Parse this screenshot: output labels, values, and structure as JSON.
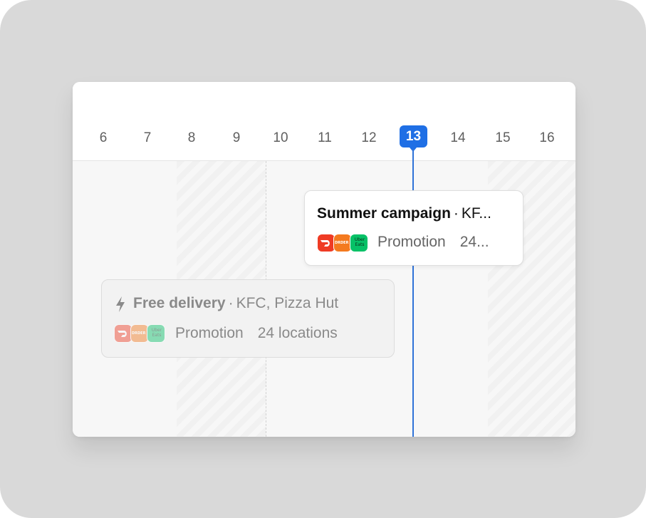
{
  "timeline": {
    "days": [
      "6",
      "7",
      "8",
      "9",
      "10",
      "11",
      "12",
      "13",
      "14",
      "15",
      "16"
    ],
    "today": "13"
  },
  "events": {
    "active": {
      "title": "Summer campaign",
      "brands": "KF...",
      "type": "Promotion",
      "locations": "24..."
    },
    "faded": {
      "title": "Free delivery",
      "brands": "KFC, Pizza Hut",
      "type": "Promotion",
      "locations": "24 locations"
    }
  },
  "logos": {
    "delivery_one": "doordash-icon",
    "delivery_two": "orange-delivery-icon",
    "delivery_three_text": "Uber Eats"
  },
  "colors": {
    "accent": "#1f6fe5",
    "today_line": "#2f73d8",
    "frame": "#d9d9d9"
  }
}
